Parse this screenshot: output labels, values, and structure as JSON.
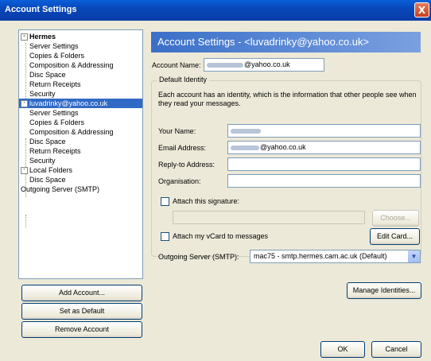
{
  "window": {
    "title": "Account Settings",
    "close_glyph": "X"
  },
  "tree": {
    "items": [
      {
        "label": "Hermes",
        "level": 0,
        "expander": "-",
        "bold": true
      },
      {
        "label": "Server Settings",
        "level": 1
      },
      {
        "label": "Copies & Folders",
        "level": 1
      },
      {
        "label": "Composition & Addressing",
        "level": 1
      },
      {
        "label": "Disc Space",
        "level": 1
      },
      {
        "label": "Return Receipts",
        "level": 1
      },
      {
        "label": "Security",
        "level": 1
      },
      {
        "label": "luvadrinky@yahoo.co.uk",
        "level": 0,
        "expander": "-",
        "selected": true
      },
      {
        "label": "Server Settings",
        "level": 1
      },
      {
        "label": "Copies & Folders",
        "level": 1
      },
      {
        "label": "Composition & Addressing",
        "level": 1
      },
      {
        "label": "Disc Space",
        "level": 1
      },
      {
        "label": "Return Receipts",
        "level": 1
      },
      {
        "label": "Security",
        "level": 1
      },
      {
        "label": "Local Folders",
        "level": 0,
        "expander": "-"
      },
      {
        "label": "Disc Space",
        "level": 1
      },
      {
        "label": "Outgoing Server (SMTP)",
        "level": 0
      }
    ]
  },
  "left_buttons": {
    "add_account": "Add Account...",
    "set_default": "Set as Default",
    "remove_account": "Remove Account"
  },
  "header": {
    "title": "Account Settings - <luvadrinky@yahoo.co.uk>"
  },
  "account_name": {
    "label": "Account Name:",
    "value_suffix": "@yahoo.co.uk"
  },
  "identity": {
    "group_title": "Default Identity",
    "description": "Each account has an identity, which is the information that other people see when they read your messages.",
    "your_name_label": "Your Name:",
    "email_label": "Email Address:",
    "email_suffix": "@yahoo.co.uk",
    "reply_to_label": "Reply-to Address:",
    "reply_to_value": "",
    "organisation_label": "Organisation:",
    "organisation_value": "",
    "attach_signature_label": "Attach this signature:",
    "signature_path": "",
    "choose_button": "Choose...",
    "attach_vcard_label": "Attach my vCard to messages",
    "edit_card_button": "Edit Card...",
    "outgoing_server_label": "Outgoing Server (SMTP):",
    "outgoing_server_value": "mac75 - smtp.hermes.cam.ac.uk (Default)"
  },
  "manage_identities_button": "Manage Identities...",
  "ok_button": "OK",
  "cancel_button": "Cancel",
  "colors": {
    "title_bar": "#0a5fd9",
    "selection": "#316ac5",
    "header": "#3a6fc8"
  }
}
